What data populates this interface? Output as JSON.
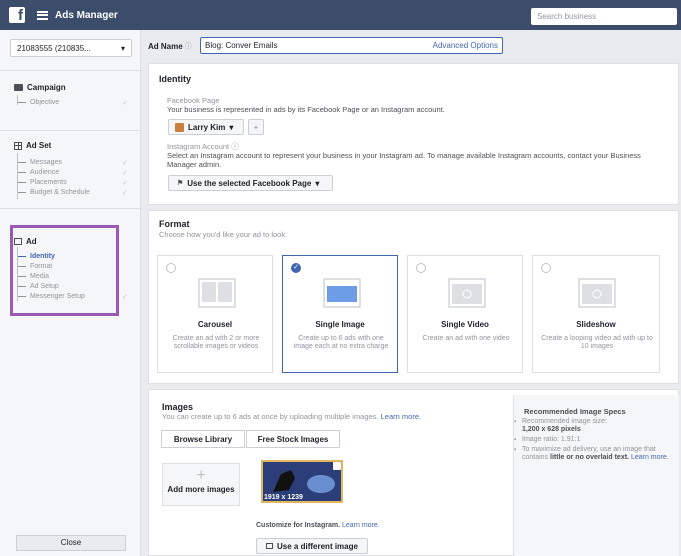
{
  "app": {
    "title": "Ads Manager",
    "search_placeholder": "Search business"
  },
  "sidebar": {
    "account": "21083555 (210835...",
    "campaign": {
      "title": "Campaign",
      "items": [
        {
          "label": "Objective"
        }
      ]
    },
    "adset": {
      "title": "Ad Set",
      "items": [
        {
          "label": "Messages"
        },
        {
          "label": "Audience"
        },
        {
          "label": "Placements"
        },
        {
          "label": "Budget & Schedule"
        }
      ]
    },
    "ad": {
      "title": "Ad",
      "items": [
        {
          "label": "Identity"
        },
        {
          "label": "Format"
        },
        {
          "label": "Media"
        },
        {
          "label": "Ad Setup"
        },
        {
          "label": "Messenger Setup"
        }
      ]
    },
    "close_label": "Close"
  },
  "adname": {
    "label": "Ad Name",
    "value": "Blog: Conver Emails",
    "advanced": "Advanced Options"
  },
  "identity": {
    "title": "Identity",
    "fb_label": "Facebook Page",
    "fb_desc": "Your business is represented in ads by its Facebook Page or an Instagram account.",
    "page_name": "Larry Kim",
    "ig_label": "Instagram Account",
    "ig_desc": "Select an Instagram account to represent your business in your Instagram ad. To manage available Instagram accounts, contact your Business Manager admin.",
    "ig_select": "Use the selected Facebook Page"
  },
  "format": {
    "title": "Format",
    "subtitle": "Choose how you'd like your ad to look.",
    "cards": [
      {
        "name": "Carousel",
        "desc": "Create an ad with 2 or more scrollable images or videos"
      },
      {
        "name": "Single Image",
        "desc": "Create up to 6 ads with one image each at no extra charge"
      },
      {
        "name": "Single Video",
        "desc": "Create an ad with one video"
      },
      {
        "name": "Slideshow",
        "desc": "Create a looping video ad with up to 10 images"
      }
    ]
  },
  "images": {
    "title": "Images",
    "desc": "You can create up to 6 ads at once by uploading multiple images.",
    "learn_more": "Learn more.",
    "tab_library": "Browse Library",
    "tab_stock": "Free Stock Images",
    "add_more": "Add more images",
    "dims": "1919 x 1239",
    "customize": "Customize for Instagram.",
    "customize_link": "Learn more.",
    "use_different": "Use a different image"
  },
  "specs": {
    "title": "Recommended Image Specs",
    "rec_size_label": "Recommended image size:",
    "rec_size": "1,200 x 628 pixels",
    "ratio": "Image ratio: 1.91:1",
    "overlay_a": "To maximize ad delivery, use an image that contains ",
    "overlay_b": "little or no overlaid text.",
    "overlay_link": "Learn more."
  }
}
